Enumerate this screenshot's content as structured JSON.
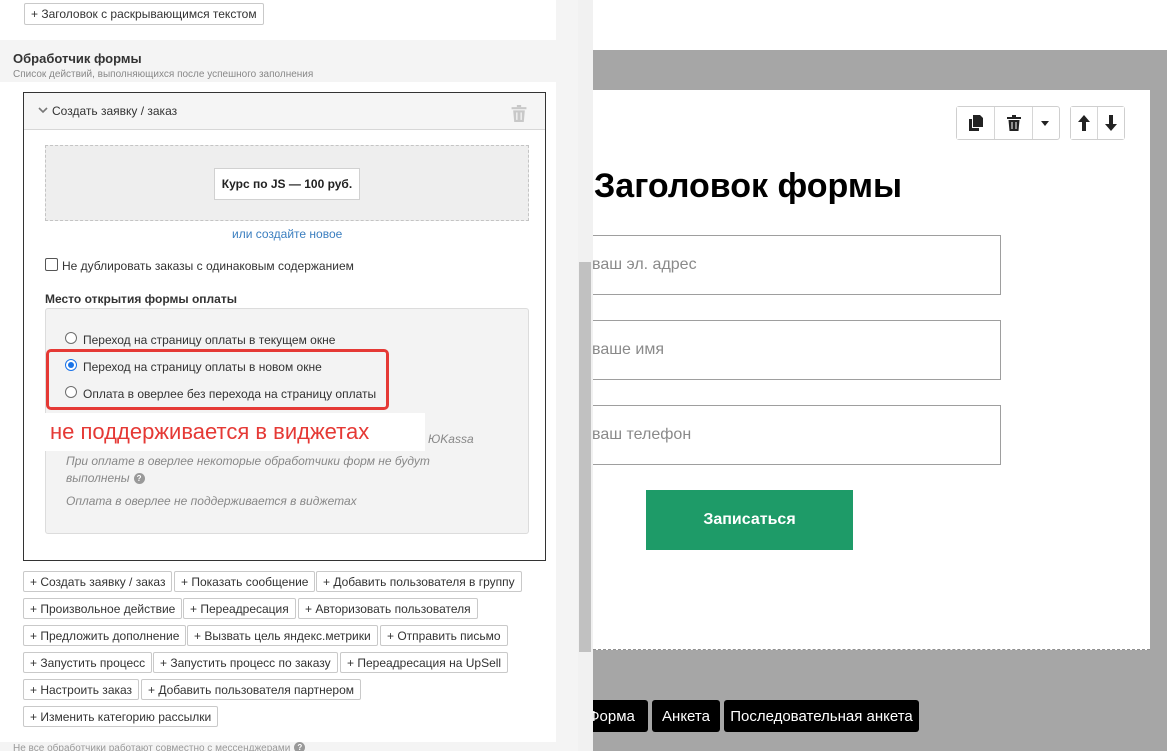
{
  "top_button": {
    "label": "+ Заголовок с раскрывающимся текстом"
  },
  "handler_section": {
    "title": "Обработчик формы",
    "subtitle": "Список действий, выполняющихся после успешного заполнения"
  },
  "action": {
    "header": "Создать заявку / заказ",
    "product": "Курс по JS — 100 руб.",
    "create_link": "или создайте новое",
    "no_duplicate_label": "Не дублировать заказы с одинаковым содержанием",
    "no_duplicate_checked": false,
    "payment_location_title": "Место открытия формы оплаты",
    "options": [
      {
        "label": "Переход на страницу оплаты в текущем окне",
        "selected": false
      },
      {
        "label": "Переход на страницу оплаты в новом окне",
        "selected": true
      },
      {
        "label": "Оплата в оверлее без перехода на страницу оплаты",
        "selected": false
      }
    ],
    "annotation": "не поддерживается в виджетах",
    "ykassa_fragment": "ЮKassa",
    "note_line1": "При оплате в оверлее некоторые обработчики форм не будут",
    "note_line2": "выполнены",
    "note_widget": "Оплата в оверлее не поддерживается в виджетах"
  },
  "add_buttons": [
    [
      "+ Создать заявку / заказ",
      "+ Показать сообщение",
      "+ Добавить пользователя в группу"
    ],
    [
      "+ Произвольное действие",
      "+ Переадресация",
      "+ Авторизовать пользователя"
    ],
    [
      "+ Предложить дополнение",
      "+ Вызвать цель яндекс.метрики",
      "+ Отправить письмо"
    ],
    [
      "+ Запустить процесс",
      "+ Запустить процесс по заказу",
      "+ Переадресация на UpSell"
    ],
    [
      "+ Настроить заказ",
      "+ Добавить пользователя партнером"
    ],
    [
      "+ Изменить категорию рассылки"
    ]
  ],
  "bottom_hint": "Не все обработчики работают совместно с мессенджерами",
  "preview": {
    "form_title": "Заголовок формы",
    "email_placeholder": "ваш эл. адрес",
    "name_placeholder": "ваше имя",
    "phone_placeholder": "ваш телефон",
    "submit_label": "Записаться",
    "tabs": [
      "Форма",
      "Анкета",
      "Последовательная анкета"
    ]
  },
  "colors": {
    "submit_green": "#1e9b68",
    "highlight_red": "#e53935",
    "link_blue": "#3a7ebf",
    "radio_blue": "#1a73e8"
  },
  "icons": [
    "copy-icon",
    "trash-icon",
    "caret-down-icon",
    "arrow-up-icon",
    "arrow-down-icon",
    "chevron-down-icon",
    "help-icon"
  ]
}
